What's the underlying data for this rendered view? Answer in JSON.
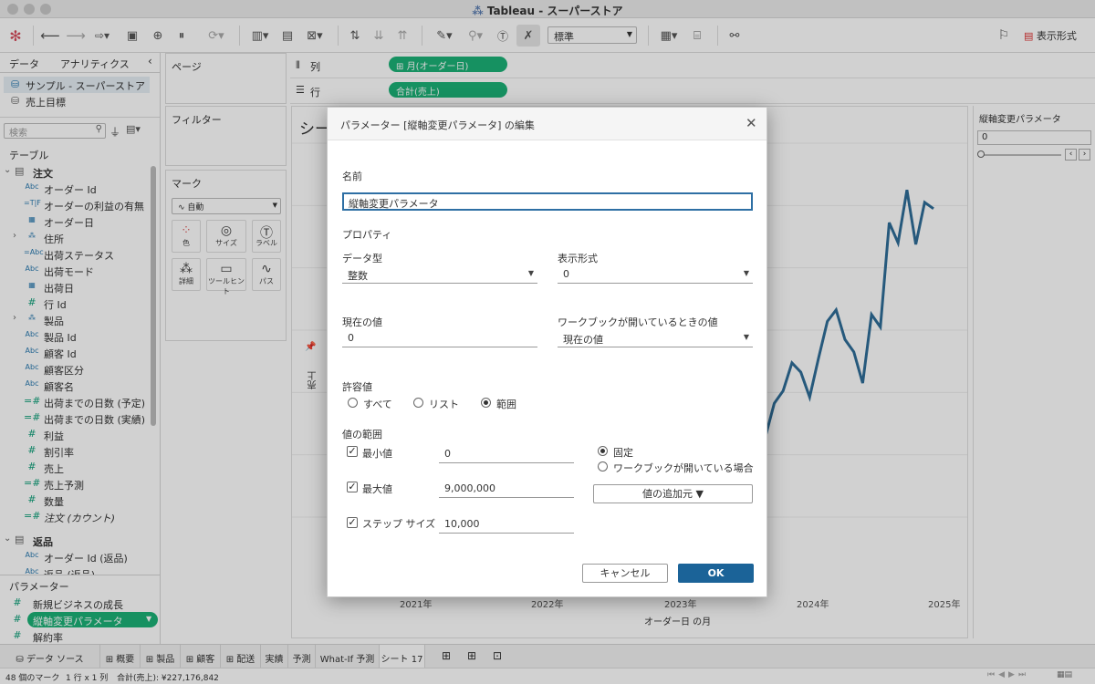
{
  "app": {
    "title": "Tableau - スーパーストア"
  },
  "toolbar": {
    "format_select": "標準",
    "show_me": "表示形式"
  },
  "data_pane": {
    "tabs": [
      "データ",
      "アナリティクス"
    ],
    "sources": [
      "サンプル - スーパーストア",
      "売上目標"
    ],
    "search_placeholder": "検索",
    "tables_header": "テーブル",
    "orders_table": "注文",
    "fields": [
      {
        "icon": "Abc",
        "label": "オーダー Id"
      },
      {
        "icon": "=T|F",
        "label": "オーダーの利益の有無"
      },
      {
        "icon": "cal",
        "label": "オーダー日"
      },
      {
        "icon": "geo",
        "label": "住所",
        "expand": true
      },
      {
        "icon": "=Abc",
        "label": "出荷ステータス"
      },
      {
        "icon": "Abc",
        "label": "出荷モード"
      },
      {
        "icon": "cal",
        "label": "出荷日"
      },
      {
        "icon": "#",
        "label": "行 Id"
      },
      {
        "icon": "geo",
        "label": "製品",
        "expand": true
      },
      {
        "icon": "Abc",
        "label": "製品 Id"
      },
      {
        "icon": "Abc",
        "label": "顧客 Id"
      },
      {
        "icon": "Abc",
        "label": "顧客区分"
      },
      {
        "icon": "Abc",
        "label": "顧客名"
      },
      {
        "icon": "=#",
        "label": "出荷までの日数 (予定)"
      },
      {
        "icon": "=#",
        "label": "出荷までの日数 (実績)"
      },
      {
        "icon": "#",
        "label": "利益"
      },
      {
        "icon": "#",
        "label": "割引率"
      },
      {
        "icon": "#",
        "label": "売上"
      },
      {
        "icon": "=#",
        "label": "売上予測"
      },
      {
        "icon": "#",
        "label": "数量"
      },
      {
        "icon": "=#",
        "label": "注文 (カウント)",
        "italic": true
      }
    ],
    "returns_table": "返品",
    "returns_fields": [
      {
        "icon": "Abc",
        "label": "オーダー Id (返品)"
      },
      {
        "icon": "Abc",
        "label": "返品 (返品)"
      }
    ],
    "params_header": "パラメーター",
    "params": [
      "新規ビジネスの成長",
      "縦軸変更パラメータ",
      "解約率"
    ]
  },
  "cards": {
    "pages": "ページ",
    "filters": "フィルター",
    "marks": "マーク",
    "marks_type": "自動",
    "mark_buttons": [
      "色",
      "サイズ",
      "ラベル",
      "詳細",
      "ツールヒント",
      "パス"
    ]
  },
  "shelves": {
    "columns_label": "列",
    "rows_label": "行",
    "columns_pill": "月(オーダー日)",
    "rows_pill": "合計(売上)"
  },
  "viz": {
    "sheet_title": "シー",
    "y_axis_label": "売上",
    "x_axis_title": "オーダー日 の月",
    "x_ticks": [
      "2021年",
      "2022年",
      "2023年",
      "2024年",
      "2025年"
    ]
  },
  "right_pane": {
    "param_title": "縦軸変更パラメータ",
    "param_value": "0"
  },
  "dialog": {
    "title": "パラメーター [縦軸変更パラメータ] の編集",
    "name_label": "名前",
    "name_value": "縦軸変更パラメータ",
    "properties": "プロパティ",
    "datatype_label": "データ型",
    "datatype_value": "整数",
    "format_label": "表示形式",
    "format_value": "0",
    "current_label": "現在の値",
    "current_value": "0",
    "workbook_label": "ワークブックが開いているときの値",
    "workbook_value": "現在の値",
    "allowed_label": "許容値",
    "allowed_options": [
      "すべて",
      "リスト",
      "範囲"
    ],
    "allowed_selected": 2,
    "range_label": "値の範囲",
    "min_label": "最小値",
    "min_value": "0",
    "max_label": "最大値",
    "max_value": "9,000,000",
    "step_label": "ステップ サイズ",
    "step_value": "10,000",
    "fixed_label": "固定",
    "when_open_label": "ワークブックが開いている場合",
    "add_from": "値の追加元 ▼",
    "cancel": "キャンセル",
    "ok": "OK"
  },
  "tabs": {
    "data_source": "データ ソース",
    "sheets": [
      "概要",
      "製品",
      "顧客",
      "配送",
      "実績",
      "予測",
      "What-If 予測",
      "シート 17"
    ]
  },
  "status": {
    "marks": "48 個のマーク",
    "rows_cols": "1 行 x 1 列",
    "sum": "合計(売上): ¥227,176,842"
  },
  "chart_data": {
    "type": "line",
    "series": [
      {
        "values": [
          270,
          248,
          235,
          220,
          258,
          365,
          405,
          495,
          465,
          385,
          510,
          628,
          665,
          570,
          530,
          430,
          650,
          610,
          945,
          880,
          1050,
          875,
          1010,
          990
        ]
      }
    ],
    "ylim": [
      0,
      1200
    ]
  }
}
